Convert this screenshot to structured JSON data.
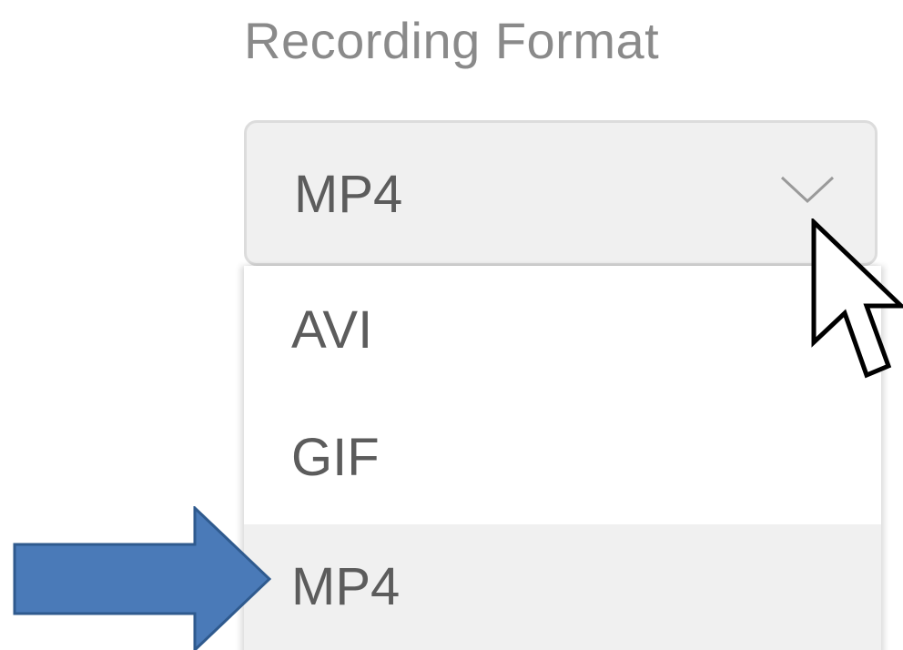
{
  "field": {
    "label": "Recording Format"
  },
  "select": {
    "value": "MP4",
    "icon": "chevron-down-icon"
  },
  "dropdown": {
    "options": [
      {
        "label": "AVI",
        "selected": false
      },
      {
        "label": "GIF",
        "selected": false
      },
      {
        "label": "MP4",
        "selected": true
      }
    ]
  },
  "annotation": {
    "arrow_color": "#4a7ab8",
    "arrow_icon": "right-arrow-icon",
    "cursor_icon": "mouse-pointer-icon"
  },
  "colors": {
    "label_text": "#8a8a8a",
    "option_text": "#5c5c5c",
    "select_bg": "#f0f0f0",
    "selected_option_bg": "#f0f0f0"
  }
}
